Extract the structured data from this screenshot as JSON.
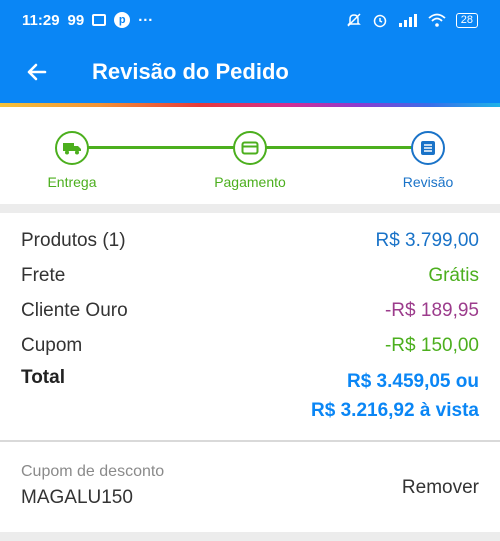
{
  "status_bar": {
    "time": "11:29",
    "notif_count": "99",
    "more": "···",
    "battery": "28"
  },
  "app_bar": {
    "title": "Revisão do Pedido"
  },
  "stepper": {
    "steps": [
      {
        "label": "Entrega",
        "icon": "truck-icon",
        "color": "#4caf1e"
      },
      {
        "label": "Pagamento",
        "icon": "card-icon",
        "color": "#4caf1e"
      },
      {
        "label": "Revisão",
        "icon": "list-icon",
        "color": "#1a73c8"
      }
    ]
  },
  "summary": {
    "rows": [
      {
        "label": "Produtos (1)",
        "value": "R$ 3.799,00",
        "color": "#1a73c8"
      },
      {
        "label": "Frete",
        "value": "Grátis",
        "color": "#4caf1e"
      },
      {
        "label": "Cliente Ouro",
        "value": "-R$ 189,95",
        "color": "#9c3c8c"
      },
      {
        "label": "Cupom",
        "value": "-R$ 150,00",
        "color": "#4caf1e"
      }
    ],
    "total": {
      "label": "Total",
      "value_installments": "R$ 3.459,05 ou",
      "value_cash": "R$ 3.216,92 à vista"
    }
  },
  "coupon": {
    "label": "Cupom de desconto",
    "code": "MAGALU150",
    "remove_label": "Remover"
  }
}
